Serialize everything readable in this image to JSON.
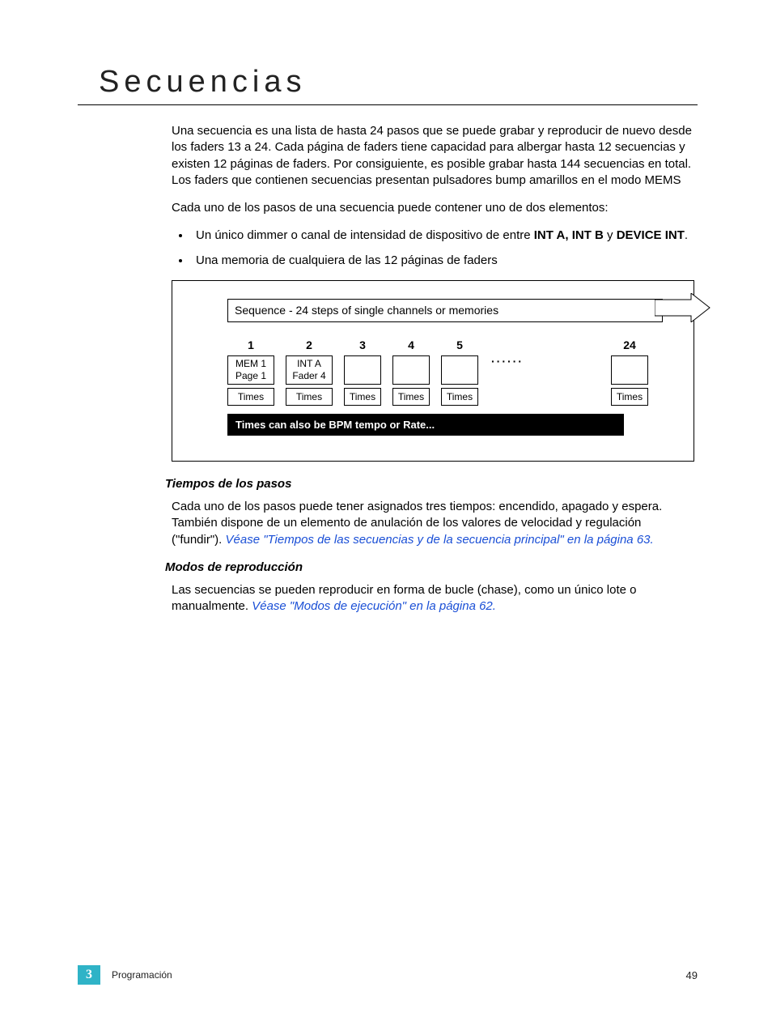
{
  "title": "Secuencias",
  "intro": "Una secuencia es una lista de hasta 24 pasos que se puede grabar y reproducir de nuevo desde los faders 13 a 24. Cada página de faders tiene capacidad para albergar hasta 12 secuencias y existen 12 páginas de faders. Por consiguiente, es posible grabar hasta 144 secuencias en total. Los faders que contienen secuencias  presentan pulsadores bump amarillos en el modo MEMS",
  "para2": "Cada uno de los pasos de una secuencia puede contener uno de dos elementos:",
  "bullets": [
    {
      "prefix": "Un único dimmer o canal de intensidad de dispositivo de entre ",
      "bold1": "INT A, INT B",
      "mid": " y ",
      "bold2": "DEVICE INT",
      "suffix": "."
    },
    {
      "text": "Una memoria de cualquiera de las 12 páginas de faders"
    }
  ],
  "diagram": {
    "header": "Sequence - 24 steps of single channels or memories",
    "steps": [
      {
        "num": "1",
        "line1": "MEM 1",
        "line2": "Page 1"
      },
      {
        "num": "2",
        "line1": "INT A",
        "line2": "Fader 4"
      },
      {
        "num": "3",
        "line1": "",
        "line2": ""
      },
      {
        "num": "4",
        "line1": "",
        "line2": ""
      },
      {
        "num": "5",
        "line1": "",
        "line2": ""
      }
    ],
    "last_step": {
      "num": "24",
      "line1": "",
      "line2": ""
    },
    "times_label": "Times",
    "footer_bar": "Times can also be BPM tempo or Rate..."
  },
  "section_times": {
    "heading": "Tiempos de los pasos",
    "body_prefix": "Cada uno de los pasos puede tener asignados tres tiempos: encendido, apagado y espera. También dispone de un elemento de anulación de los valores de velocidad y regulación (\"fundir\"). ",
    "link": "Véase \"Tiempos de las secuencias y de la secuencia principal\" en la página  63."
  },
  "section_modes": {
    "heading": "Modos de reproducción",
    "body_prefix": "Las secuencias se pueden reproducir en forma de bucle (chase), como un único lote o manualmente. ",
    "link": "Véase \"Modos de ejecución\" en la página  62."
  },
  "footer": {
    "chapter_number": "3",
    "chapter_name": "Programación",
    "page_number": "49"
  }
}
